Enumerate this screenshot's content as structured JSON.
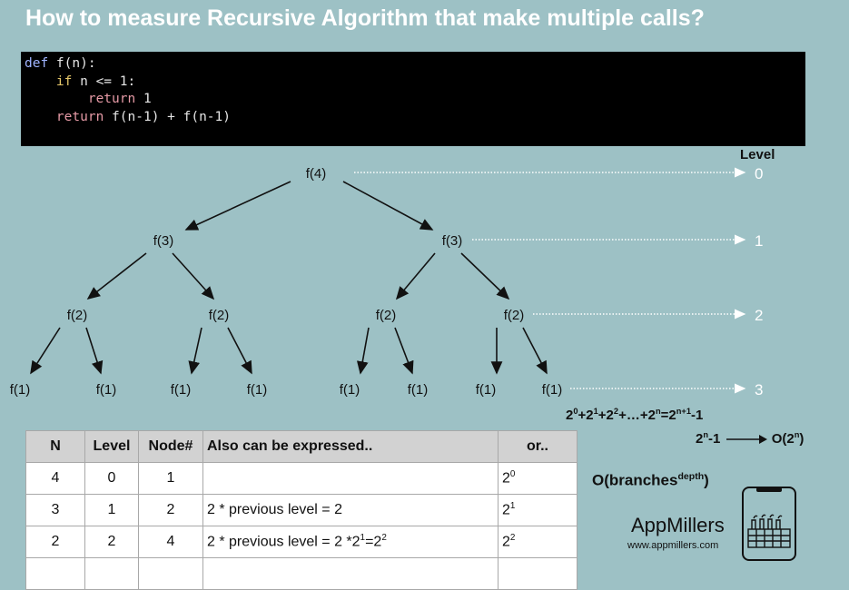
{
  "title": "How to measure Recursive Algorithm that make multiple calls?",
  "code": {
    "line1_kw": "def",
    "line1_rest": " f(n):",
    "line2_kw": "if",
    "line2_rest": " n <= 1:",
    "line3_kw": "return",
    "line3_rest": " 1",
    "line4_kw": "return",
    "line4_rest": " f(n-1) + f(n-1)"
  },
  "tree": {
    "root": "f(4)",
    "level1": [
      "f(3)",
      "f(3)"
    ],
    "level2": [
      "f(2)",
      "f(2)",
      "f(2)",
      "f(2)"
    ],
    "level3": [
      "f(1)",
      "f(1)",
      "f(1)",
      "f(1)",
      "f(1)",
      "f(1)",
      "f(1)",
      "f(1)"
    ]
  },
  "levels": {
    "title": "Level",
    "values": [
      "0",
      "1",
      "2",
      "3"
    ]
  },
  "formulas": {
    "sum_html": "2<sup>0</sup>+2<sup>1</sup>+2<sup>2</sup>+…+2<sup>n</sup>=2<sup>n+1</sup>-1",
    "complexity_left_html": "2<sup>n</sup>-1",
    "complexity_right_html": "O(2<sup>n</sup>)",
    "general_html": "O(branches<sup>depth</sup>)"
  },
  "table": {
    "headers": [
      "N",
      "Level",
      "Node#",
      "Also can be expressed..",
      "or.."
    ],
    "rows": [
      {
        "n": "4",
        "level": "0",
        "nodes": "1",
        "expr": "",
        "alt_html": "2<sup>0</sup>"
      },
      {
        "n": "3",
        "level": "1",
        "nodes": "2",
        "expr": "2 * previous level = 2",
        "alt_html": "2<sup>1</sup>"
      },
      {
        "n": "2",
        "level": "2",
        "nodes": "4",
        "expr_html": "2 * previous level = 2 *2<sup>1</sup>=2<sup>2</sup>",
        "alt_html": "2<sup>2</sup>"
      }
    ]
  },
  "brand": {
    "name": "AppMillers",
    "url": "www.appmillers.com"
  },
  "colors": {
    "background": "#9dc1c5",
    "code_background": "#000000",
    "level_text": "#ffffff"
  }
}
